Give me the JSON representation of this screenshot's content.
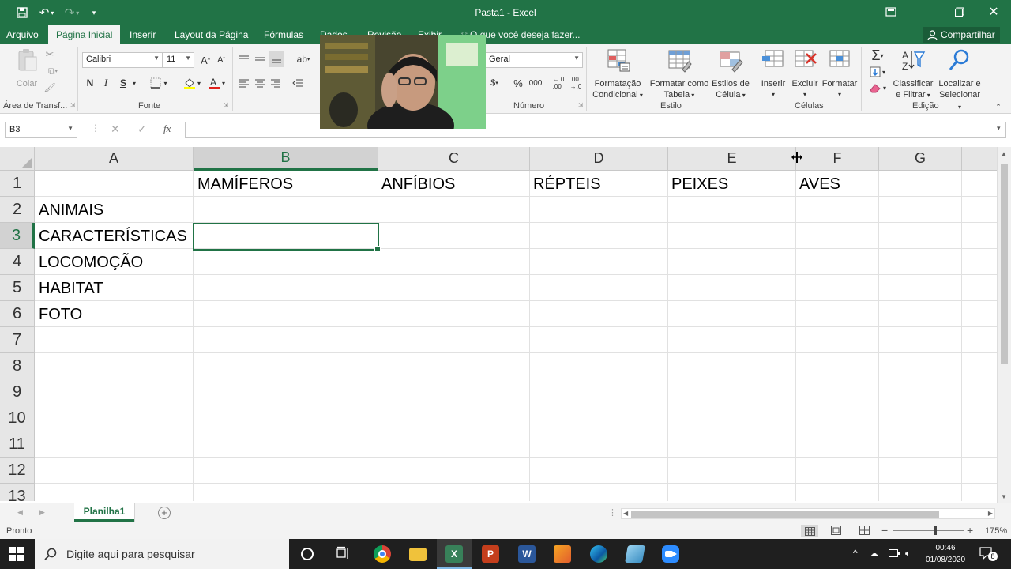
{
  "window": {
    "title": "Pasta1 - Excel"
  },
  "ribbon_tabs": [
    "Arquivo",
    "Página Inicial",
    "Inserir",
    "Layout da Página",
    "Fórmulas",
    "Dados",
    "Revisão",
    "Exibir"
  ],
  "tell_me": "O que você deseja fazer...",
  "share_label": "Compartilhar",
  "ribbon": {
    "clipboard": {
      "paste_label": "Colar",
      "group_label": "Área de Transf..."
    },
    "font": {
      "family": "Calibri",
      "size": "11",
      "bold": "N",
      "italic": "I",
      "underline": "S",
      "group_label": "Fonte"
    },
    "number": {
      "format": "Geral",
      "group_label": "Número"
    },
    "styles": {
      "conditional_line1": "Formatação",
      "conditional_line2": "Condicional",
      "table_line1": "Formatar como",
      "table_line2": "Tabela",
      "cell_line1": "Estilos de",
      "cell_line2": "Célula",
      "group_label": "Estilo"
    },
    "cells": {
      "insert": "Inserir",
      "delete": "Excluir",
      "format": "Formatar",
      "group_label": "Células"
    },
    "editing": {
      "sort_line1": "Classificar",
      "sort_line2": "e Filtrar",
      "find_line1": "Localizar e",
      "find_line2": "Selecionar",
      "group_label": "Edição"
    }
  },
  "formula_bar": {
    "name_box": "B3",
    "fx": "fx",
    "value": ""
  },
  "sheet": {
    "columns": [
      "A",
      "B",
      "C",
      "D",
      "E",
      "F",
      "G"
    ],
    "selected_column": "B",
    "rows": [
      "1",
      "2",
      "3",
      "4",
      "5",
      "6",
      "7",
      "8",
      "9",
      "10",
      "11",
      "12",
      "13"
    ],
    "selected_row": "3",
    "cells": {
      "B1": "MAMÍFEROS",
      "C1": "ANFÍBIOS",
      "D1": "RÉPTEIS",
      "E1": "PEIXES",
      "F1": "AVES",
      "A2": "ANIMAIS",
      "A3": "CARACTERÍSTICAS",
      "A4": "LOCOMOÇÃO",
      "A5": "HABITAT",
      "A6": "FOTO"
    }
  },
  "sheet_tabs": [
    "Planilha1"
  ],
  "status": {
    "ready": "Pronto",
    "zoom": "175%"
  },
  "taskbar": {
    "search_placeholder": "Digite aqui para pesquisar",
    "time": "00:46",
    "date": "01/08/2020",
    "notifications": "8"
  },
  "colors": {
    "excel_green": "#217346",
    "ribbon_bg": "#f3f3f3",
    "taskbar": "#1f1f1f"
  }
}
